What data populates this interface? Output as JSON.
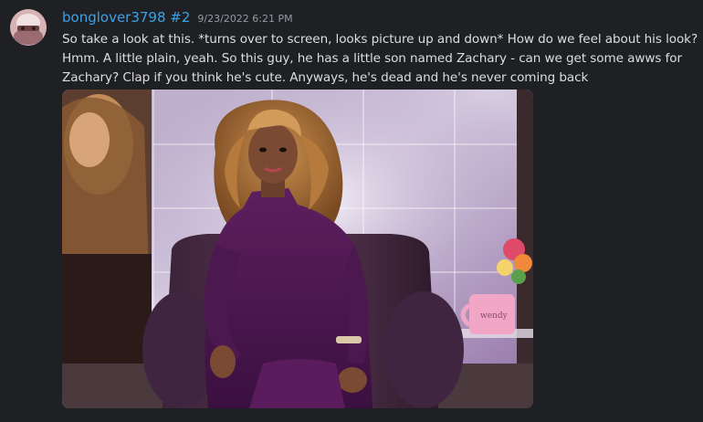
{
  "message": {
    "username": "bonglover3798 #2",
    "timestamp": "9/23/2022 6:21 PM",
    "content": "So take a look at this. *turns over to screen, looks picture up and down* How do we feel about his look? Hmm. A little plain, yeah. So this guy, he has a little son named Zachary - can we get some awws for Zachary? Clap if you think he's cute. Anyways, he's dead and he's never coming back",
    "attachment": {
      "mug_text": "wendy",
      "description_icon": "image-attachment"
    }
  },
  "colors": {
    "background": "#1f2023",
    "username": "#3aa3e8",
    "text": "#dbdee1",
    "timestamp": "#949ba4"
  }
}
